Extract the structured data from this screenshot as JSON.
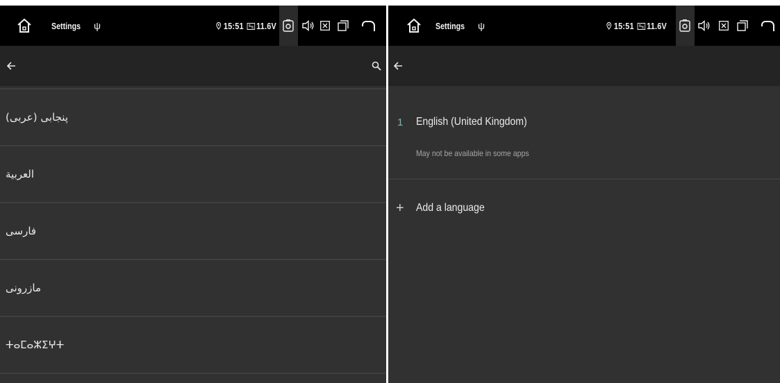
{
  "left": {
    "status_bar": {
      "title": "Settings",
      "usb_symbol": "ψ",
      "time": "15:51",
      "voltage": "11.6V",
      "icons": [
        "home-icon",
        "usb-icon",
        "location-icon",
        "battery-icon",
        "screenshot-icon",
        "volume-icon",
        "close-app-icon",
        "recent-apps-icon",
        "back-arrow-icon"
      ]
    },
    "app_bar": {
      "back_icon": "arrow-left-icon",
      "search_icon": "search-icon"
    },
    "languages": [
      "پنجابی (عربی)",
      "العربية",
      "فارسی",
      "مازرونی",
      "ⵜⴰⵎⴰⵣⵉⵖⵜ"
    ]
  },
  "right": {
    "status_bar": {
      "title": "Settings",
      "usb_symbol": "ψ",
      "time": "15:51",
      "voltage": "11.6V",
      "icons": [
        "home-icon",
        "usb-icon",
        "location-icon",
        "battery-icon",
        "screenshot-icon",
        "volume-icon",
        "close-app-icon",
        "recent-apps-icon",
        "back-arrow-icon"
      ]
    },
    "app_bar": {
      "back_icon": "arrow-left-icon"
    },
    "selected_language": {
      "index": "1",
      "name": "English (United Kingdom)",
      "note": "May not be available in some apps"
    },
    "add_language": {
      "icon": "+",
      "label": "Add a language"
    }
  },
  "colors": {
    "status_bar": "#000000",
    "app_bar": "#242424",
    "background": "#313131",
    "divider": "#3f3f3f",
    "index_accent": "#7fb5b0"
  }
}
